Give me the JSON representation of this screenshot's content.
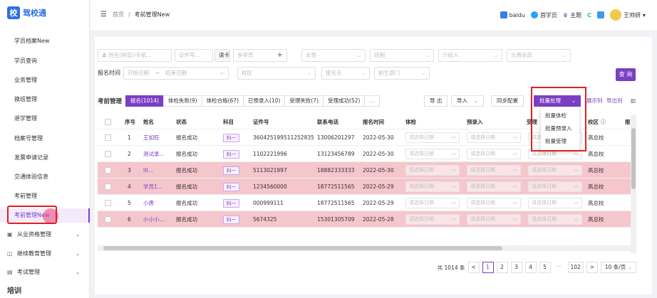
{
  "brand": {
    "logo_char": "校",
    "name": "驾校通",
    "color": "#2f6fe4"
  },
  "accent": "#7b3fc4",
  "sidebar": {
    "items": [
      {
        "label": "学员档案New"
      },
      {
        "label": "学员查询"
      },
      {
        "label": "业务管理"
      },
      {
        "label": "换班管理"
      },
      {
        "label": "退学管理"
      },
      {
        "label": "档案号管理"
      },
      {
        "label": "发票申请记录"
      },
      {
        "label": "交通体验信息"
      },
      {
        "label": "考前管理"
      },
      {
        "label": "考前管理New"
      }
    ],
    "groups": [
      {
        "label": "从业资格管理",
        "icon": "id-card-icon"
      },
      {
        "label": "继续教育管理",
        "icon": "book-icon"
      },
      {
        "label": "考试管理",
        "icon": "exam-icon"
      }
    ],
    "bottom_label": "培训"
  },
  "header": {
    "breadcrumb": [
      "首页",
      "考前管理New"
    ],
    "right_items": [
      {
        "label": "baidu",
        "color": "#3a7bf0"
      },
      {
        "label": "首学员",
        "color": "#29a3f1"
      },
      {
        "label": "主题",
        "color": "#7b3fc4"
      }
    ],
    "user": "王帅妍"
  },
  "filters": {
    "name_placeholder": "姓名(拼音)/手机...",
    "cert_placeholder": "证件号...",
    "read_card": "读卡",
    "student_tag": "多学员",
    "car_type": "车型",
    "class_type": "班制",
    "introducer": "介绍人",
    "fee_status": "欠费状态",
    "date_label": "报名时间",
    "start_date": "开始日期",
    "date_sep": "→",
    "end_date": "结束日期",
    "campus": "校区",
    "signup_point": "报名点",
    "dept": "前生部门",
    "query": "查 询"
  },
  "tabs": {
    "title": "考前管理",
    "items": [
      {
        "label": "报名(1014)",
        "active": true
      },
      {
        "label": "体检失败(9)"
      },
      {
        "label": "体检合格(67)"
      },
      {
        "label": "已预录入(10)"
      },
      {
        "label": "受理失败(7)"
      },
      {
        "label": "受理成功(52)"
      },
      {
        "label": "…"
      }
    ]
  },
  "toolbar": {
    "export": "导 出",
    "import": "导入",
    "sync": "同步配置",
    "batch": "批量处理",
    "show_cols": "展示列",
    "export_cols": "导出列"
  },
  "batch_menu": [
    "批量体检",
    "批量预录入",
    "批量受理"
  ],
  "table": {
    "columns": [
      "序号",
      "姓名",
      "状态",
      "科目",
      "证件号",
      "联系电话",
      "报名时间",
      "体检",
      "预录入",
      "受理",
      "校区",
      "报"
    ],
    "date_placeholder": "请选择日期",
    "rows": [
      {
        "no": "1",
        "name": "王如旺",
        "status": "报名成功",
        "subject": "科一",
        "id": "360425199511252835",
        "phone": "13006201297",
        "date": "2022-05-30",
        "campus": "高总校",
        "pink": false
      },
      {
        "no": "2",
        "name": "测试录...",
        "status": "报名成功",
        "subject": "科一",
        "id": "1102221996",
        "phone": "13123456789",
        "date": "2022-05-30",
        "campus": "高总校",
        "pink": false
      },
      {
        "no": "3",
        "name": "III...",
        "status": "报名成功",
        "subject": "科一",
        "id": "5113021997",
        "phone": "18882333333",
        "date": "2022-05-30",
        "campus": "高总校",
        "pink": true
      },
      {
        "no": "4",
        "name": "学员1...",
        "status": "报名成功",
        "subject": "科一",
        "id": "1234560000",
        "phone": "18772511565",
        "date": "2022-05-29",
        "campus": "高总校",
        "pink": true
      },
      {
        "no": "5",
        "name": "小唐",
        "status": "报名成功",
        "subject": "科一",
        "id": "000999111",
        "phone": "18772511565",
        "date": "2022-05-29",
        "campus": "高总校",
        "pink": false
      },
      {
        "no": "6",
        "name": "小小小...",
        "status": "报名成功",
        "subject": "科一",
        "id": "5674325",
        "phone": "15301305709",
        "date": "2022-05-28",
        "campus": "高总校",
        "pink": true
      }
    ]
  },
  "pagination": {
    "total": "共 1014 条",
    "pages": [
      "1",
      "2",
      "3",
      "4",
      "5",
      "···",
      "102"
    ],
    "current": "1",
    "size": "10 条/页"
  }
}
